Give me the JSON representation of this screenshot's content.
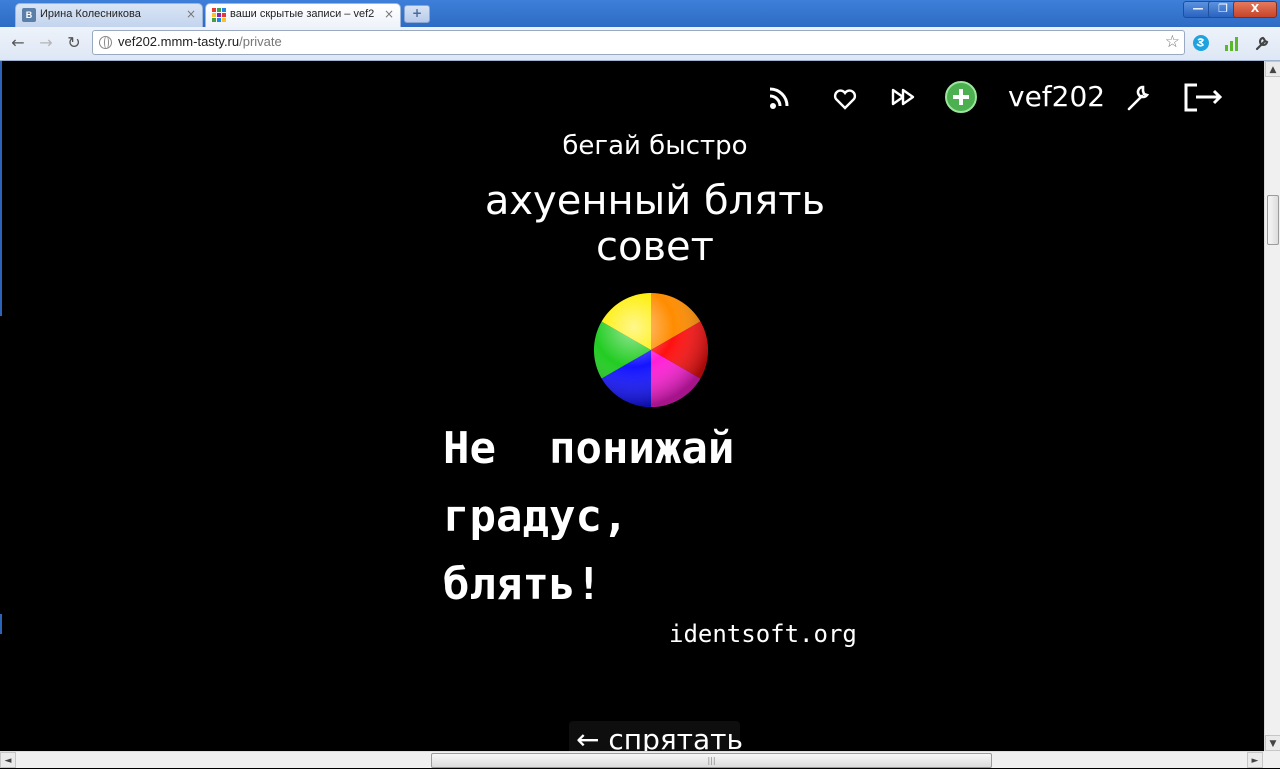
{
  "browser": {
    "tabs": [
      {
        "title": "Ирина Колесникова",
        "active": false,
        "close": "×"
      },
      {
        "title": "ваши скрытые записи – vef2",
        "active": true,
        "close": "×"
      }
    ],
    "new_tab": "+",
    "window_controls": {
      "minimize": "—",
      "maximize": "❐",
      "close": "X"
    },
    "nav": {
      "back": "←",
      "forward": "→",
      "reload": "↻"
    },
    "url": {
      "host": "vef202.mmm-tasty.ru",
      "path": "/private"
    },
    "bookmark_star": "☆"
  },
  "page": {
    "username": "vef202",
    "subtitle": "бегай быстро",
    "heading_line1": "ахуенный блять",
    "heading_line2": "совет",
    "poster_line1": "Не  понижай",
    "poster_line2": "градус,",
    "poster_line3": "блять!",
    "watermark": "identsoft.org",
    "hide_button": "← спрятать",
    "icons": [
      "rss-icon",
      "heart-icon",
      "fast-forward-icon",
      "add-icon",
      "settings-icon",
      "logout-icon"
    ],
    "colors": {
      "background": "#000000",
      "text": "#ffffff",
      "add_icon_green": "#4caf50"
    }
  },
  "scroll": {
    "up": "▲",
    "down": "▼",
    "left": "◄",
    "right": "►",
    "grip": "|||"
  }
}
